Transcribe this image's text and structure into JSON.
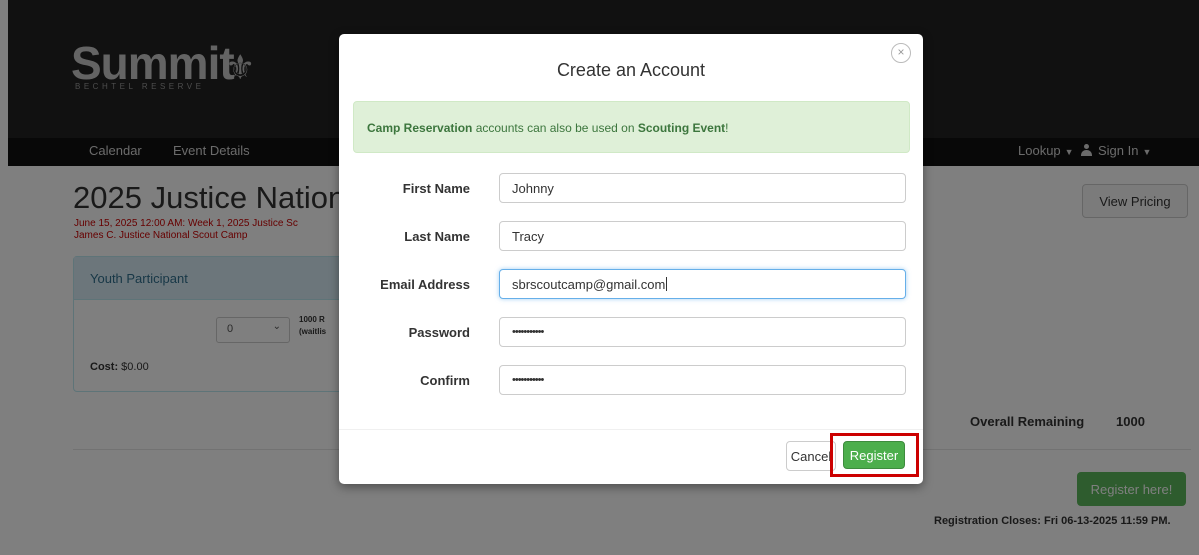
{
  "brand": {
    "name": "Summit",
    "sub": "BECHTEL RESERVE"
  },
  "nav": {
    "left_items": [
      "Calendar",
      "Event Details"
    ],
    "lookup": "Lookup",
    "sign_in": "Sign In"
  },
  "event": {
    "title": "2025 Justice Nationa",
    "subtitle1": "June 15, 2025 12:00 AM: Week 1, 2025 Justice Sc",
    "subtitle2": "James C. Justice National Scout Camp",
    "view_pricing": "View Pricing",
    "panel_title": "Youth Participant",
    "qty_value": "0",
    "avail_line1": "1000 R",
    "avail_line2": "(waitlis",
    "cost_label": "Cost:",
    "cost_value": "$0.00",
    "remaining_label": "Overall Remaining",
    "remaining_value": "1000",
    "register_here": "Register here!",
    "reg_closes": "Registration Closes: Fri 06-13-2025 11:59 PM."
  },
  "modal": {
    "title": "Create an Account",
    "close_symbol": "×",
    "alert": {
      "bold1": "Camp Reservation",
      "middle": " accounts can also be used on ",
      "bold2": "Scouting Event",
      "end": "!"
    },
    "fields": [
      {
        "label": "First Name",
        "value": "Johnny"
      },
      {
        "label": "Last Name",
        "value": "Tracy"
      },
      {
        "label": "Email Address",
        "value": "sbrscoutcamp@gmail.com"
      },
      {
        "label": "Password",
        "value": "•••••••••••"
      },
      {
        "label": "Confirm",
        "value": "•••••••••••"
      }
    ],
    "cancel": "Cancel",
    "register": "Register"
  },
  "colors": {
    "highlight": "#cc0000",
    "success": "#5cb85c",
    "alert_bg": "#dff0d8"
  }
}
